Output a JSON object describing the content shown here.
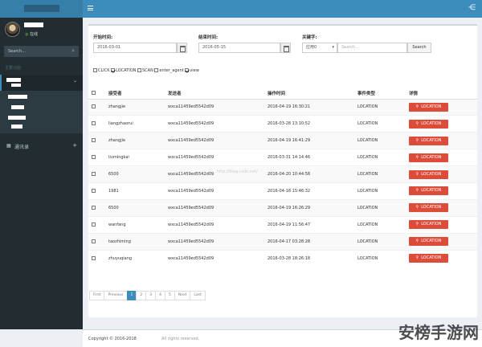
{
  "user": {
    "status": "在线"
  },
  "sidebar": {
    "search_placeholder": "Search...",
    "header": "主要功能",
    "item_label": "通讯录"
  },
  "filters": {
    "start_label": "开始时间:",
    "start_value": "2016-03-01",
    "end_label": "结束时间:",
    "end_value": "2016-05-15",
    "keyword_label": "关键字:",
    "select_value": "应用0",
    "search_placeholder": "Search...",
    "search_button": "Search",
    "checkboxes": [
      {
        "label": "CLICK",
        "checked": false
      },
      {
        "label": "LOCATION",
        "checked": true
      },
      {
        "label": "SCAN",
        "checked": false
      },
      {
        "label": "enter_agent",
        "checked": false
      },
      {
        "label": "view",
        "checked": true
      }
    ]
  },
  "table": {
    "headers": [
      "接受者",
      "发送者",
      "操作时间",
      "事件类型",
      "详情"
    ],
    "action_label": "LOCATION",
    "rows": [
      {
        "receiver": "zhangjie",
        "sender": "wxca11459ed5542d09",
        "time": "2016-04-19 16:30:21",
        "event": "LOCATION"
      },
      {
        "receiver": "liangzhaorui",
        "sender": "wxca11459ed5542d09",
        "time": "2016-03-28 13:10:52",
        "event": "LOCATION"
      },
      {
        "receiver": "zhangjie",
        "sender": "wxca11459ed5542d09",
        "time": "2016-04-19 16:41:29",
        "event": "LOCATION"
      },
      {
        "receiver": "liumingkai",
        "sender": "wxca11459ed5542d09",
        "time": "2016-03-31 14:14:46",
        "event": "LOCATION"
      },
      {
        "receiver": "6500",
        "sender": "wxca11459ed5542d09",
        "time": "2016-04-20 10:44:58",
        "event": "LOCATION"
      },
      {
        "receiver": "1981",
        "sender": "wxca11459ed5542d09",
        "time": "2016-04-18 15:46:32",
        "event": "LOCATION"
      },
      {
        "receiver": "6500",
        "sender": "wxca11459ed5542d09",
        "time": "2016-04-19 16:26:29",
        "event": "LOCATION"
      },
      {
        "receiver": "wanfang",
        "sender": "wxca11459ed5542d09",
        "time": "2016-04-19 11:56:47",
        "event": "LOCATION"
      },
      {
        "receiver": "taozhiming",
        "sender": "wxca11459ed5542d09",
        "time": "2016-04-17 03:28:28",
        "event": "LOCATION"
      },
      {
        "receiver": "zhuyuqiang",
        "sender": "wxca11459ed5542d09",
        "time": "2016-03-28 18:26:18",
        "event": "LOCATION"
      }
    ]
  },
  "pagination": [
    "First",
    "Previous",
    "1",
    "2",
    "3",
    "4",
    "5",
    "Next",
    "Last"
  ],
  "pagination_active": "1",
  "footer": {
    "copyright": "Copyright © 2016-2018",
    "rights": "All rights reserved."
  },
  "watermark": "安榜手游网",
  "center_watermark": "http://blog.csdn.net/"
}
